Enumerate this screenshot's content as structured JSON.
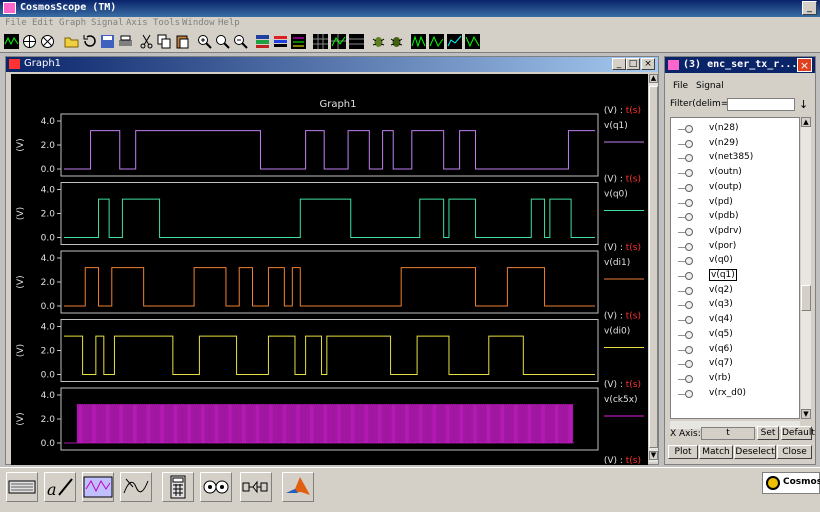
{
  "app": {
    "title": "CosmosScope (TM)",
    "menu": [
      "File",
      "Edit",
      "Graph",
      "Signal",
      "Axis",
      "Tools",
      "Window",
      "Help"
    ]
  },
  "graph_window": {
    "title": "Graph1",
    "graph_title": "Graph1"
  },
  "chart_data": {
    "type": "line",
    "title": "Graph1",
    "x_label": "t",
    "x_unit": "(s)",
    "panels": [
      {
        "name": "v(q1)",
        "color": "#c080f0",
        "ylabel": "(V)",
        "ylim": [
          0,
          4.0
        ],
        "ticks": [
          "4.0",
          "2.0",
          "0.0"
        ],
        "yaxis_label": "(V) : t(s)",
        "segments": [
          [
            0,
            0
          ],
          [
            0.05,
            3.2
          ],
          [
            0.105,
            0
          ],
          [
            0.135,
            3.2
          ],
          [
            0.37,
            0
          ],
          [
            0.455,
            3.2
          ],
          [
            0.49,
            0
          ],
          [
            0.535,
            3.2
          ],
          [
            0.575,
            0
          ],
          [
            0.6,
            3.2
          ],
          [
            0.62,
            0
          ],
          [
            0.655,
            3.2
          ],
          [
            0.715,
            0
          ],
          [
            0.745,
            3.2
          ],
          [
            0.775,
            0
          ],
          [
            0.95,
            3.2
          ],
          [
            1.0,
            3.2
          ]
        ]
      },
      {
        "name": "v(q0)",
        "color": "#40e0a0",
        "ylabel": "(V)",
        "ylim": [
          0,
          4.0
        ],
        "ticks": [
          "4.0",
          "2.0",
          "0.0"
        ],
        "yaxis_label": "(V) : t(s)",
        "segments": [
          [
            0,
            0
          ],
          [
            0.065,
            3.2
          ],
          [
            0.085,
            0
          ],
          [
            0.11,
            3.2
          ],
          [
            0.18,
            0
          ],
          [
            0.445,
            3.2
          ],
          [
            0.54,
            0
          ],
          [
            0.67,
            3.2
          ],
          [
            0.715,
            0
          ],
          [
            0.725,
            3.2
          ],
          [
            0.775,
            0
          ],
          [
            0.88,
            3.2
          ],
          [
            0.905,
            0
          ],
          [
            0.915,
            3.2
          ],
          [
            0.955,
            0
          ],
          [
            1.0,
            0
          ]
        ]
      },
      {
        "name": "v(di1)",
        "color": "#f08030",
        "ylabel": "(V)",
        "ylim": [
          0,
          4.0
        ],
        "ticks": [
          "4.0",
          "2.0",
          "0.0"
        ],
        "yaxis_label": "(V) : t(s)",
        "segments": [
          [
            0,
            0
          ],
          [
            0.04,
            3.2
          ],
          [
            0.065,
            0
          ],
          [
            0.09,
            3.2
          ],
          [
            0.15,
            0
          ],
          [
            0.245,
            3.2
          ],
          [
            0.305,
            0
          ],
          [
            0.33,
            3.2
          ],
          [
            0.355,
            0
          ],
          [
            0.385,
            3.2
          ],
          [
            0.415,
            0
          ],
          [
            0.43,
            3.2
          ],
          [
            0.445,
            0
          ],
          [
            0.635,
            3.2
          ],
          [
            0.775,
            0
          ],
          [
            0.835,
            3.2
          ],
          [
            0.905,
            0
          ],
          [
            1.0,
            0
          ]
        ]
      },
      {
        "name": "v(di0)",
        "color": "#e8e040",
        "ylabel": "(V)",
        "ylim": [
          0,
          4.0
        ],
        "ticks": [
          "4.0",
          "2.0",
          "0.0"
        ],
        "yaxis_label": "(V) : t(s)",
        "segments": [
          [
            0,
            3.2
          ],
          [
            0.035,
            0
          ],
          [
            0.06,
            3.2
          ],
          [
            0.075,
            0
          ],
          [
            0.095,
            3.2
          ],
          [
            0.205,
            0
          ],
          [
            0.255,
            3.2
          ],
          [
            0.325,
            0
          ],
          [
            0.385,
            3.2
          ],
          [
            0.435,
            0
          ],
          [
            0.455,
            3.2
          ],
          [
            0.485,
            0
          ],
          [
            0.495,
            3.2
          ],
          [
            0.615,
            0
          ],
          [
            0.665,
            3.2
          ],
          [
            0.725,
            0
          ],
          [
            0.8,
            3.2
          ],
          [
            0.865,
            0
          ],
          [
            1.0,
            0
          ]
        ]
      },
      {
        "name": "v(ck5x)",
        "color": "#e020e0",
        "ylabel": "(V)",
        "ylim": [
          0,
          4.0
        ],
        "ticks": [
          "4.0",
          "2.0",
          "0.0"
        ],
        "yaxis_label": "(V) : t(s)",
        "clock": {
          "start": 0.025,
          "end": 0.96,
          "high": 3.2
        }
      }
    ]
  },
  "signal_panel": {
    "title": "(3)  enc_ser_tx_r...",
    "menu_file": "File",
    "menu_signal": "Signal",
    "filter_label": "Filter(delim=\",\")",
    "filter_value": "",
    "signals": [
      "v(n28)",
      "v(n29)",
      "v(net385)",
      "v(outn)",
      "v(outp)",
      "v(pd)",
      "v(pdb)",
      "v(pdrv)",
      "v(por)",
      "v(q0)",
      "v(q1)",
      "v(q2)",
      "v(q3)",
      "v(q4)",
      "v(q5)",
      "v(q6)",
      "v(q7)",
      "v(rb)",
      "v(rx_d0)"
    ],
    "selected_signal": "v(q1)",
    "xaxis_label": "X Axis:",
    "xaxis_value": "t",
    "set_label": "Set",
    "default_label": "Default",
    "buttons": [
      "Plot",
      "Match",
      "Deselect",
      "Close"
    ]
  },
  "brand": {
    "text": "CosmosS"
  },
  "colors": {
    "accent": "#0a246a",
    "plot_bg": "#000000",
    "yaxis_label_t": "#ff3030"
  }
}
